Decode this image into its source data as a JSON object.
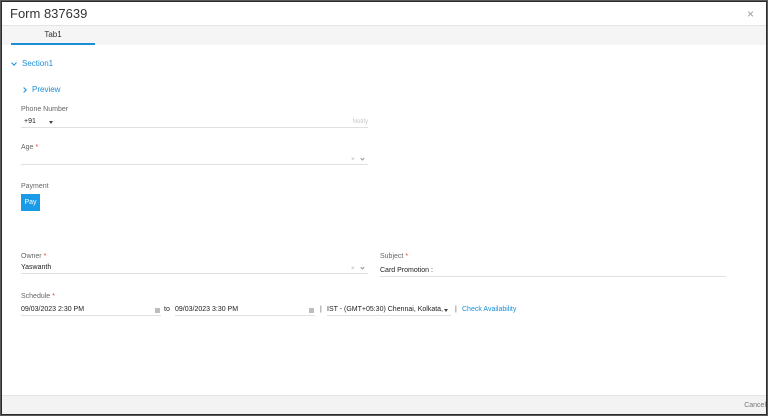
{
  "window": {
    "title": "Form 837639",
    "close_glyph": "×"
  },
  "tabs": [
    {
      "label": "Tab1",
      "active": true
    }
  ],
  "section": {
    "label": "Section1",
    "icon": "chevron-down-icon"
  },
  "preview": {
    "label": "Preview",
    "icon": "chevron-right-icon"
  },
  "phone": {
    "label": "Phone Number",
    "country_code": "+91",
    "placeholder": "Notify"
  },
  "age": {
    "label": "Age",
    "required_mark": "*",
    "value": ""
  },
  "payment": {
    "label": "Payment",
    "button_label": "Pay"
  },
  "owner": {
    "label": "Owner",
    "required_mark": "*",
    "value": "Yaswanth"
  },
  "subject": {
    "label": "Subject",
    "required_mark": "*",
    "value": "Card Promotion :"
  },
  "schedule": {
    "label": "Schedule",
    "required_mark": "*",
    "start": "09/03/2023 2:30 PM",
    "to_label": "to",
    "end": "09/03/2023 3:30 PM",
    "separator": "|",
    "timezone": "IST - (GMT+05:30) Chennai, Kolkata,",
    "check_availability": "Check Availability"
  },
  "footer": {
    "cancel_label": "Cancel"
  },
  "colors": {
    "accent": "#1a8fd8",
    "button": "#1a9be8",
    "required": "#e0473b"
  },
  "icons": {
    "clear": "×"
  }
}
